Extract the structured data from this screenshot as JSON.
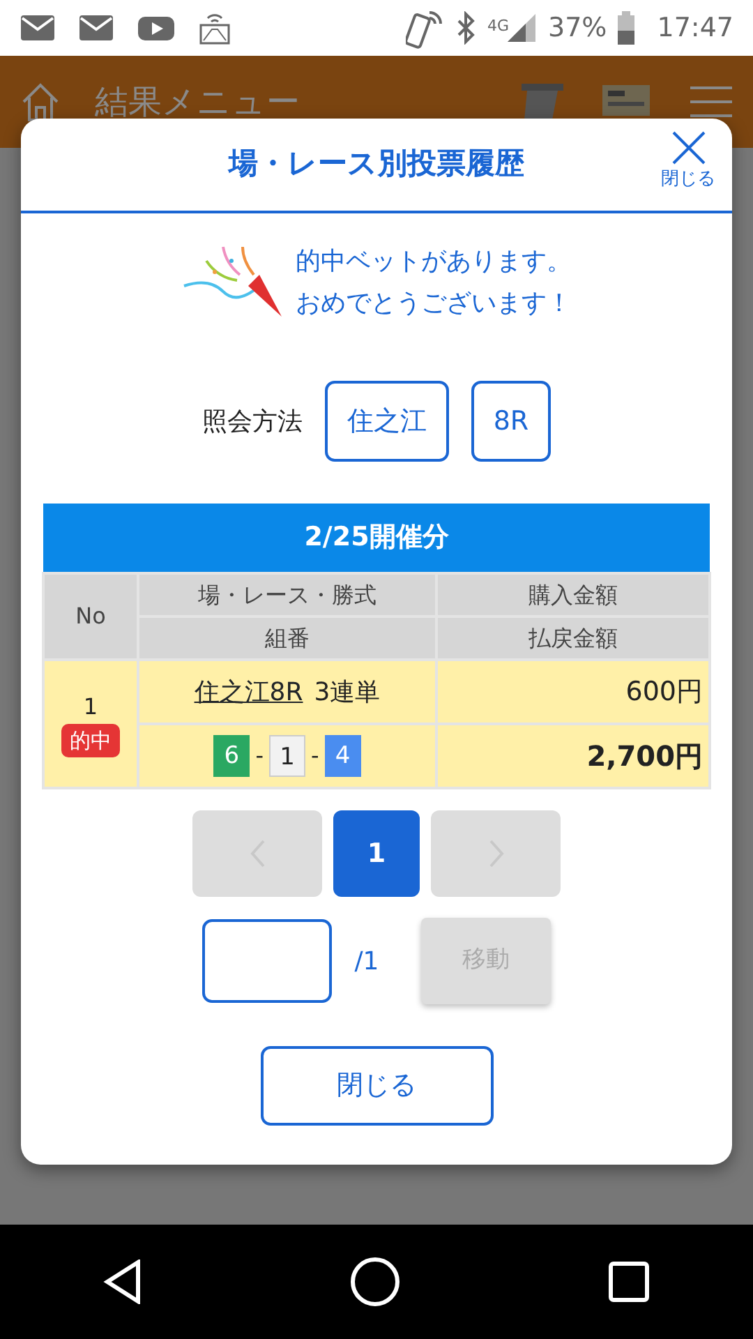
{
  "status_bar": {
    "network": "4G",
    "battery": "37%",
    "time": "17:47"
  },
  "background": {
    "title": "結果メニュー"
  },
  "dialog": {
    "title": "場・レース別投票履歴",
    "close_label": "閉じる",
    "message": [
      "的中ベットがあります。",
      "おめでとうございます！"
    ],
    "query": {
      "label": "照会方法",
      "chips": [
        "住之江",
        "8R"
      ]
    },
    "table": {
      "caption": "2/25開催分",
      "columns": {
        "no": "No",
        "race": "場・レース・勝式",
        "combo": "組番",
        "purchase": "購入金額",
        "payout": "払戻金額"
      },
      "rows": [
        {
          "no": "1",
          "badge": "的中",
          "race_link": "住之江8R",
          "bet_type": "3連単",
          "separators": [
            "-",
            "-"
          ],
          "numbers": [
            {
              "value": "6",
              "color": "#2aa862"
            },
            {
              "value": "1",
              "color": "#f2f2f2"
            },
            {
              "value": "4",
              "color": "#4a8df0"
            }
          ],
          "purchase": "600円",
          "payout": "2,700円"
        }
      ]
    },
    "pagination": {
      "pages": [
        {
          "label": "1",
          "selected": true
        }
      ],
      "prev_disabled": true,
      "next_disabled": true
    },
    "jump": {
      "total": "/1",
      "button": "移動",
      "disabled": true
    },
    "close_button": "閉じる"
  }
}
